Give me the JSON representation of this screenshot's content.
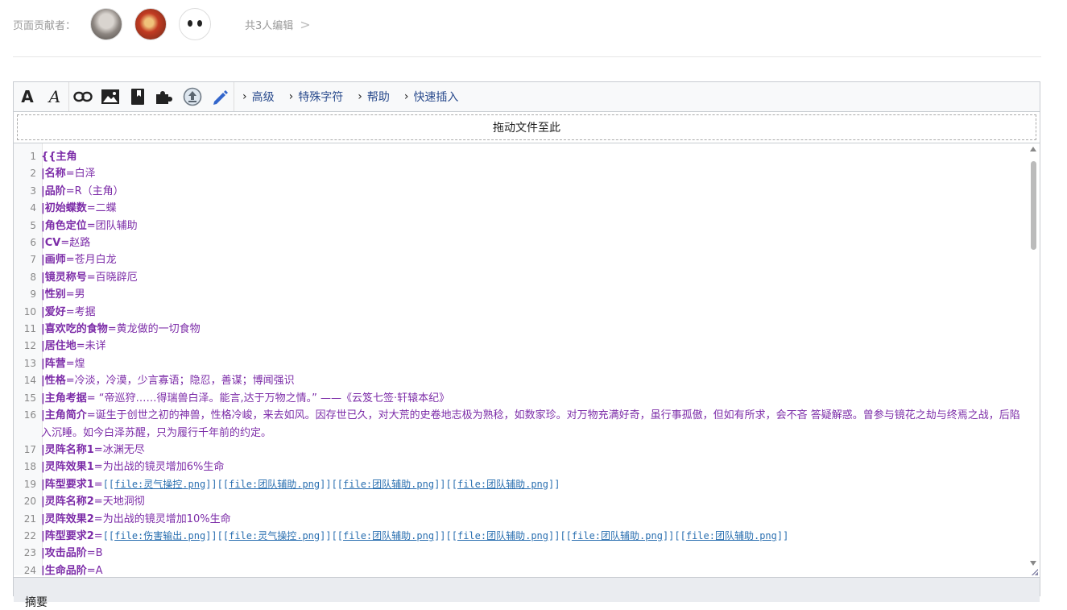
{
  "contributors": {
    "label": "页面贡献者：",
    "avatars": [
      "avatar-1",
      "avatar-2",
      "avatar-3"
    ],
    "editors_link": "共3人编辑",
    "chevron": ">"
  },
  "toolbar": {
    "bold_glyph": "A",
    "italic_glyph": "A",
    "menus": [
      "高级",
      "特殊字符",
      "帮助",
      "快速插入"
    ]
  },
  "dropzone": {
    "label": "拖动文件至此"
  },
  "footer": {
    "label": "摘要"
  },
  "code_lines": [
    {
      "n": "1",
      "k": "{{主角",
      "v": ""
    },
    {
      "n": "2",
      "k": "|名称",
      "v": "=白泽"
    },
    {
      "n": "3",
      "k": "|品阶",
      "v": "=R（主角）"
    },
    {
      "n": "4",
      "k": "|初始蝶数",
      "v": "=二蝶"
    },
    {
      "n": "5",
      "k": "|角色定位",
      "v": "=团队辅助"
    },
    {
      "n": "6",
      "k": "|CV",
      "v": "=赵路"
    },
    {
      "n": "7",
      "k": "|画师",
      "v": "=苍月白龙"
    },
    {
      "n": "8",
      "k": "|镜灵称号",
      "v": "=百晓辟厄"
    },
    {
      "n": "9",
      "k": "|性别",
      "v": "=男"
    },
    {
      "n": "10",
      "k": "|爱好",
      "v": "=考据"
    },
    {
      "n": "11",
      "k": "|喜欢吃的食物",
      "v": "=黄龙做的一切食物"
    },
    {
      "n": "12",
      "k": "|居住地",
      "v": "=未详"
    },
    {
      "n": "13",
      "k": "|阵营",
      "v": "=煌"
    },
    {
      "n": "14",
      "k": "|性格",
      "v": "=冷淡，冷漠，少言寡语；隐忍，善谋；博闻强识"
    },
    {
      "n": "15",
      "k": "|主角考据",
      "v": "= “帝巡狩……得瑞兽白泽。能言,达于万物之情。” ——《云笈七签·轩辕本纪》"
    },
    {
      "n": "16",
      "k": "|主角简介",
      "v": "=诞生于创世之初的神兽，性格冷峻，来去如风。因存世已久，对大荒的史卷地志极为熟稔，如数家珍。对万物充满好奇，虽行事孤傲，但如有所求，会不吝 答疑解惑。曾参与镜花之劫与终焉之战，后陷入沉睡。如今白泽苏醒，只为履行千年前的约定。"
    },
    {
      "n": "17",
      "k": "|灵阵名称1",
      "v": "=冰渊无尽"
    },
    {
      "n": "18",
      "k": "|灵阵效果1",
      "v": "=为出战的镜灵增加6%生命"
    },
    {
      "n": "19",
      "k": "|阵型要求1",
      "v": "=",
      "links": [
        "file:灵气操控.png",
        "file:团队辅助.png",
        "file:团队辅助.png",
        "file:团队辅助.png"
      ]
    },
    {
      "n": "20",
      "k": "|灵阵名称2",
      "v": "=天地洞彻"
    },
    {
      "n": "21",
      "k": "|灵阵效果2",
      "v": "=为出战的镜灵增加10%生命"
    },
    {
      "n": "22",
      "k": "|阵型要求2",
      "v": "=",
      "links": [
        "file:伤害输出.png",
        "file:灵气操控.png",
        "file:团队辅助.png",
        "file:团队辅助.png",
        "file:团队辅助.png",
        "file:团队辅助.png"
      ]
    },
    {
      "n": "23",
      "k": "|攻击品阶",
      "v": "=B"
    },
    {
      "n": "24",
      "k": "|生命品阶",
      "v": "=A"
    }
  ]
}
